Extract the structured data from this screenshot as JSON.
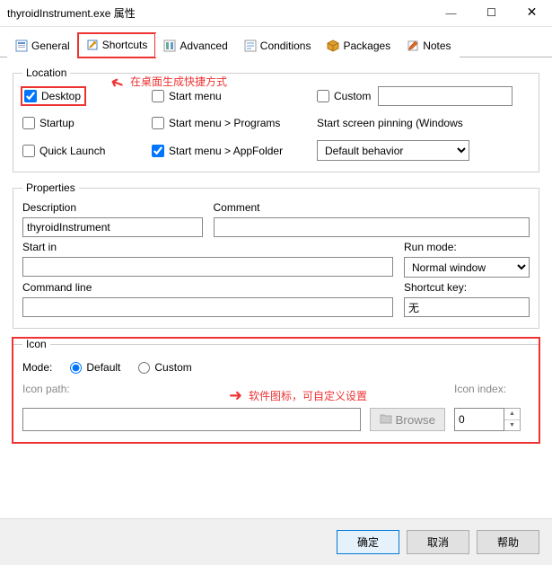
{
  "window": {
    "title": "thyroidInstrument.exe 属性"
  },
  "tabs": {
    "general": "General",
    "shortcuts": "Shortcuts",
    "advanced": "Advanced",
    "conditions": "Conditions",
    "packages": "Packages",
    "notes": "Notes"
  },
  "annotations": {
    "desktop_hint": "在桌面生成快捷方式",
    "icon_hint": "软件图标，可自定义设置"
  },
  "location": {
    "legend": "Location",
    "desktop": "Desktop",
    "startmenu": "Start menu",
    "custom": "Custom",
    "custom_value": "",
    "startup": "Startup",
    "programs": "Start menu > Programs",
    "pinning": "Start screen pinning (Windows",
    "quicklaunch": "Quick Launch",
    "appfolder": "Start menu > AppFolder",
    "default_behavior": "Default behavior"
  },
  "properties": {
    "legend": "Properties",
    "description_label": "Description",
    "comment_label": "Comment",
    "description_value": "thyroidInstrument",
    "comment_value": "",
    "startin_label": "Start in",
    "runmode_label": "Run mode:",
    "startin_value": "",
    "runmode_value": "Normal window",
    "cmdline_label": "Command line",
    "shortcutkey_label": "Shortcut key:",
    "cmdline_value": "",
    "shortcutkey_value": "无"
  },
  "icon": {
    "legend": "Icon",
    "mode_label": "Mode:",
    "default": "Default",
    "custom": "Custom",
    "path_label": "Icon path:",
    "path_value": "",
    "browse": "Browse",
    "index_label": "Icon index:",
    "index_value": "0"
  },
  "buttons": {
    "ok": "确定",
    "cancel": "取消",
    "help": "帮助"
  }
}
